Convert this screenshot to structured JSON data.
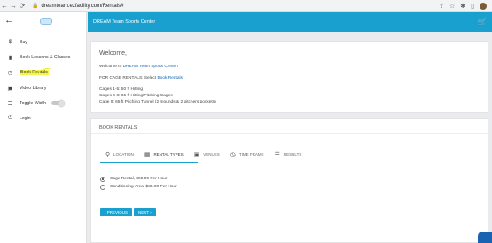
{
  "browser": {
    "url": "dreamteam.ezfacility.com/Rentals#",
    "nav_back": "←",
    "nav_forward": "→",
    "reload": "⟳"
  },
  "sidebar": {
    "items": [
      {
        "label": "Buy",
        "icon": "dollar-icon"
      },
      {
        "label": "Book Lessons & Classes",
        "icon": "book-icon"
      },
      {
        "label": "Book Rentals",
        "icon": "clock-icon"
      },
      {
        "label": "Video Library",
        "icon": "video-library-icon"
      },
      {
        "label": "Toggle Width",
        "icon": "toggle-width-icon"
      },
      {
        "label": "Login",
        "icon": "power-icon"
      }
    ]
  },
  "topbar": {
    "title": "DREAM Team Sports Center"
  },
  "welcome": {
    "heading": "Welcome,",
    "line1_prefix": "Welcome to ",
    "line1_name": "DREAM Team Sports Center!",
    "line2_prefix": "FOR CAGE RENTALS: Select ",
    "line2_link": "Book Rentals",
    "cages": [
      "Cages 1-5: 50 ft Hitting",
      "Cages 6-8: 65 ft Hitting/Pitching Cages",
      "Cage 9: 65 ft Pitching Tunnel (2 mounds & 2 pitchers pockets)"
    ]
  },
  "book_rentals": {
    "heading": "BOOK RENTALS",
    "tabs": [
      {
        "label": "LOCATION",
        "icon": "location-pin-icon"
      },
      {
        "label": "RENTAL TYPES",
        "icon": "calendar-icon"
      },
      {
        "label": "VENUES",
        "icon": "venue-icon"
      },
      {
        "label": "TIME FRAME",
        "icon": "clock-icon"
      },
      {
        "label": "RESULTS",
        "icon": "list-icon"
      }
    ],
    "options": [
      {
        "label": "Cage Rental, $50.00 Per Hour",
        "checked": true
      },
      {
        "label": "Conditioning Area, $35.00 Per Hour",
        "checked": false
      }
    ],
    "previous_label": "‹ PREVIOUS",
    "next_label": "NEXT ›"
  },
  "colors": {
    "accent": "#1aa0cf",
    "link": "#1a63b2",
    "highlight": "#f4f44a"
  }
}
